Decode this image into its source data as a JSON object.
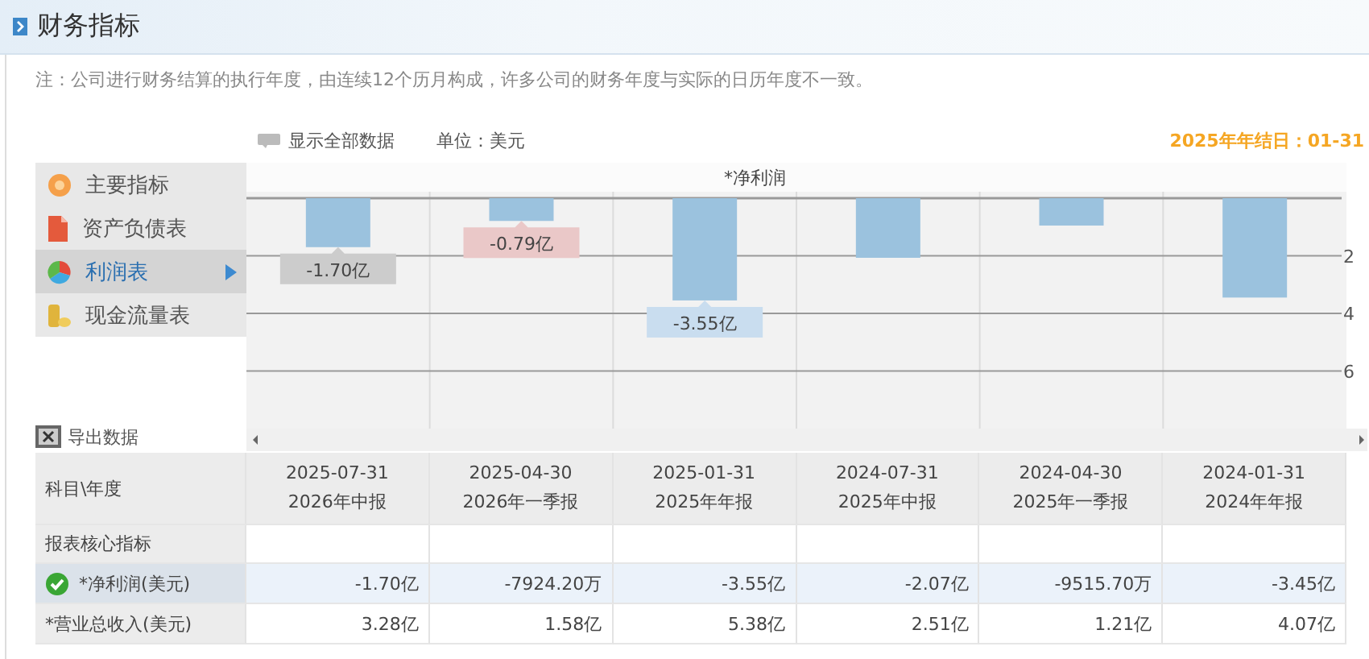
{
  "header": {
    "title": "财务指标"
  },
  "note": "注：公司进行财务结算的执行年度，由连续12个历月构成，许多公司的财务年度与实际的日历年度不一致。",
  "toolbar": {
    "show_all": "显示全部数据",
    "unit": "单位：美元",
    "year_end": "2025年年结日：01-31"
  },
  "sidebar": {
    "items": [
      {
        "label": "主要指标",
        "selected": false
      },
      {
        "label": "资产负债表",
        "selected": false
      },
      {
        "label": "利润表",
        "selected": true
      },
      {
        "label": "现金流量表",
        "selected": false
      }
    ],
    "export": "导出数据"
  },
  "chart_data": {
    "type": "bar",
    "grid": true,
    "series": [
      {
        "name": "*净利润",
        "color": "#9bc2de",
        "values": [
          -1.7,
          -0.79,
          -3.55,
          -2.07,
          -0.95,
          -3.45
        ]
      }
    ],
    "ylim": [
      -8,
      0
    ],
    "yticks": [
      {
        "value": -2,
        "label": "2"
      },
      {
        "value": -4,
        "label": "4"
      },
      {
        "value": -6,
        "label": "6"
      }
    ]
  },
  "chart_tooltips": [
    {
      "text": "-1.70亿",
      "color": "#cccccc"
    },
    {
      "text": "-0.79亿",
      "color": "#eac8c8"
    },
    {
      "text": "-3.55亿",
      "color": "#c9ddef"
    }
  ],
  "table": {
    "corner": "科目\\年度",
    "columns": [
      {
        "date": "2025-07-31",
        "report": "2026年中报"
      },
      {
        "date": "2025-04-30",
        "report": "2026年一季报"
      },
      {
        "date": "2025-01-31",
        "report": "2025年年报"
      },
      {
        "date": "2024-07-31",
        "report": "2025年中报"
      },
      {
        "date": "2024-04-30",
        "report": "2025年一季报"
      },
      {
        "date": "2024-01-31",
        "report": "2024年年报"
      }
    ],
    "rows": [
      {
        "kind": "section",
        "label": "报表核心指标"
      },
      {
        "kind": "data",
        "label": "*净利润(美元)",
        "selected": true,
        "values": [
          "-1.70亿",
          "-7924.20万",
          "-3.55亿",
          "-2.07亿",
          "-9515.70万",
          "-3.45亿"
        ]
      },
      {
        "kind": "data",
        "label": "*营业总收入(美元)",
        "selected": false,
        "values": [
          "3.28亿",
          "1.58亿",
          "5.38亿",
          "2.51亿",
          "1.21亿",
          "4.07亿"
        ]
      }
    ]
  }
}
